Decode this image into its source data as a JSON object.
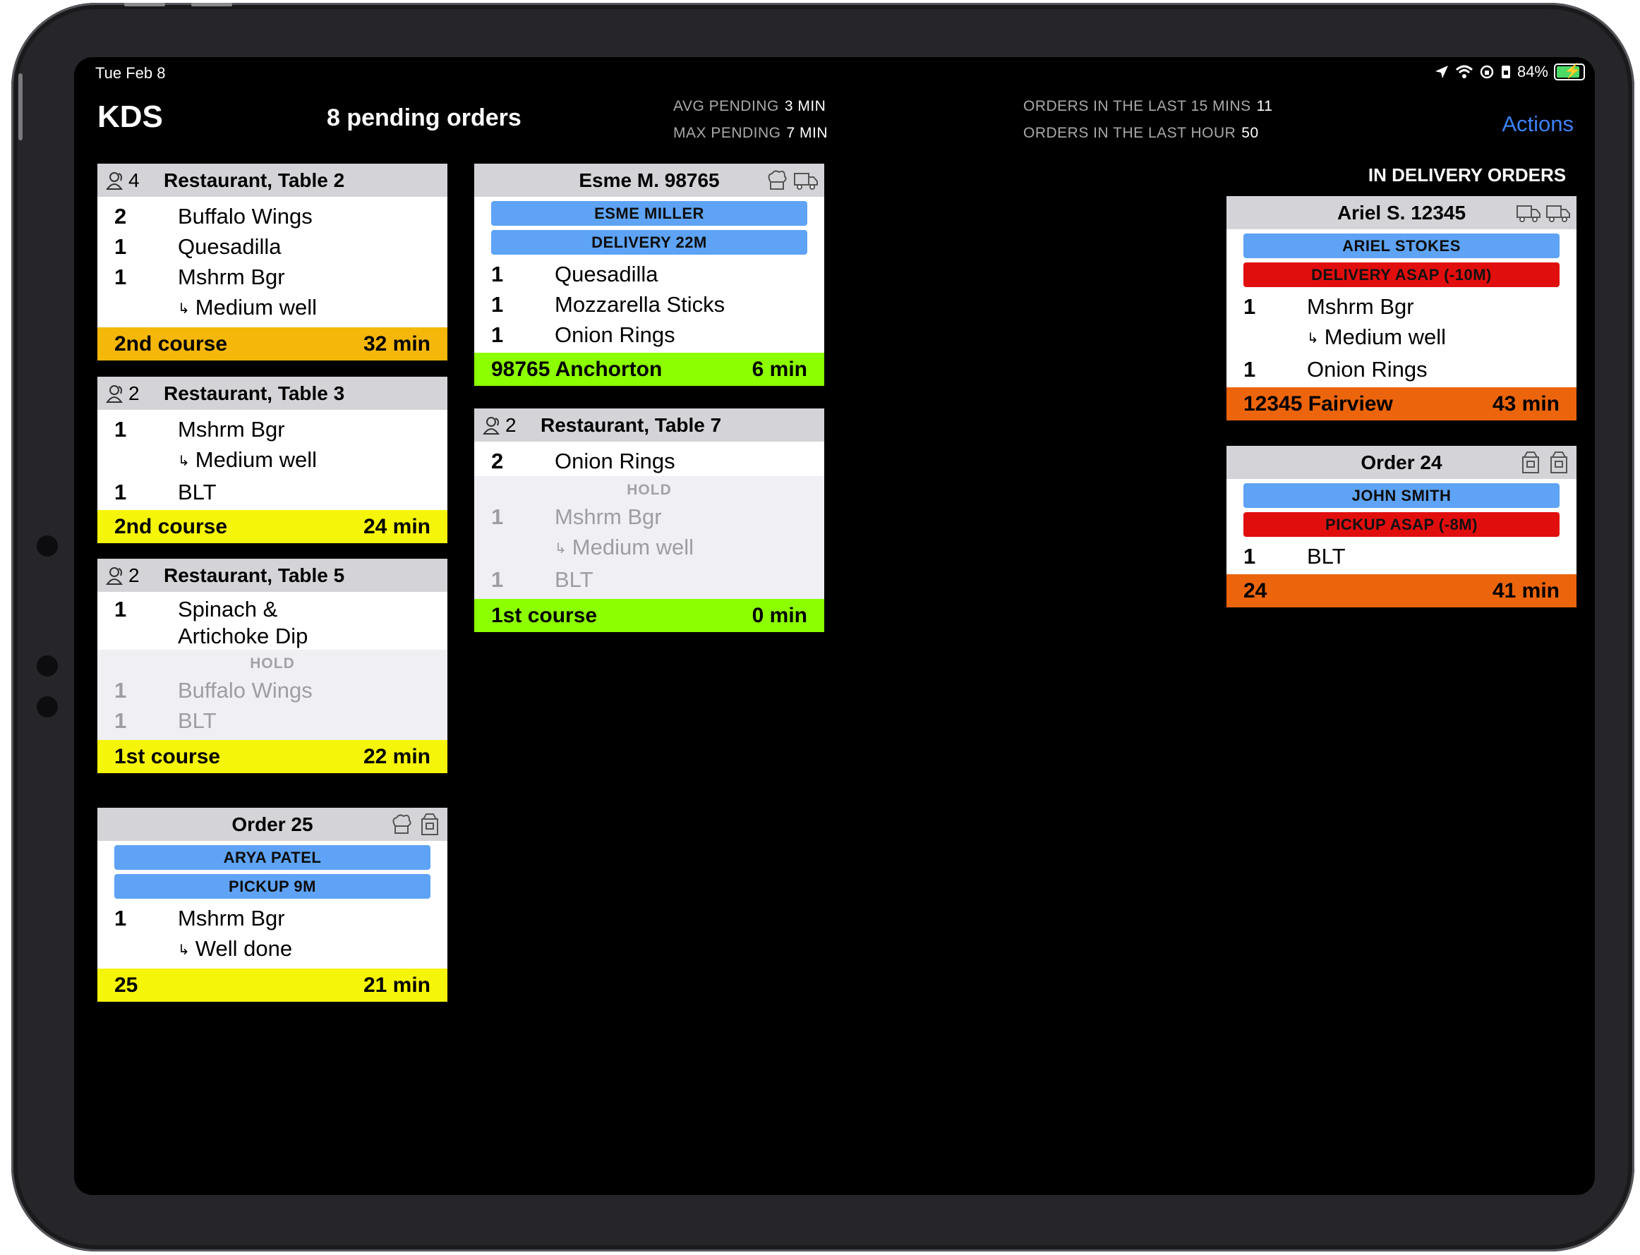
{
  "status_bar": {
    "date": "Tue Feb 8",
    "battery": "84%"
  },
  "header": {
    "title": "KDS",
    "pending": "8 pending orders",
    "avg_pending_label": "AVG PENDING",
    "avg_pending_value": "3 MIN",
    "max_pending_label": "MAX PENDING",
    "max_pending_value": "7 MIN",
    "last15_label": "ORDERS IN THE LAST 15 MINS",
    "last15_value": "11",
    "lasthour_label": "ORDERS IN THE LAST HOUR",
    "lasthour_value": "50",
    "actions": "Actions"
  },
  "delivery_heading": "IN DELIVERY ORDERS",
  "tickets": {
    "t2": {
      "guests": "4",
      "title": "Restaurant, Table 2",
      "items": [
        {
          "qty": "2",
          "name": "Buffalo Wings"
        },
        {
          "qty": "1",
          "name": "Quesadilla"
        },
        {
          "qty": "1",
          "name": "Mshrm Bgr"
        }
      ],
      "mods": [
        "Medium well"
      ],
      "footer_left": "2nd course",
      "footer_right": "32 min"
    },
    "t3": {
      "guests": "2",
      "title": "Restaurant, Table 3",
      "items": [
        {
          "qty": "1",
          "name": "Mshrm Bgr"
        },
        {
          "qty": "1",
          "name": "BLT"
        }
      ],
      "mods": [
        "Medium well"
      ],
      "footer_left": "2nd course",
      "footer_right": "24 min"
    },
    "t5": {
      "guests": "2",
      "title": "Restaurant, Table 5",
      "items": [
        {
          "qty": "1",
          "name": "Spinach &"
        },
        {
          "qty": "",
          "name": "Artichoke Dip"
        }
      ],
      "hold_label": "HOLD",
      "held": [
        {
          "qty": "1",
          "name": "Buffalo Wings"
        },
        {
          "qty": "1",
          "name": "BLT"
        }
      ],
      "footer_left": "1st course",
      "footer_right": "22 min"
    },
    "o25": {
      "title": "Order 25",
      "customer": "ARYA  PATEL",
      "timing": "PICKUP 9M",
      "items": [
        {
          "qty": "1",
          "name": "Mshrm Bgr"
        }
      ],
      "mods": [
        "Well done"
      ],
      "footer_left": "25",
      "footer_right": "21 min"
    },
    "esme": {
      "title": "Esme  M. 98765",
      "customer": "ESME  MILLER",
      "timing": "DELIVERY 22M",
      "items": [
        {
          "qty": "1",
          "name": "Quesadilla"
        },
        {
          "qty": "1",
          "name": "Mozzarella Sticks"
        },
        {
          "qty": "1",
          "name": "Onion Rings"
        }
      ],
      "footer_left": "98765 Anchorton",
      "footer_right": "6 min"
    },
    "t7": {
      "guests": "2",
      "title": "Restaurant, Table 7",
      "items": [
        {
          "qty": "2",
          "name": "Onion Rings"
        }
      ],
      "hold_label": "HOLD",
      "held": [
        {
          "qty": "1",
          "name": "Mshrm Bgr"
        },
        {
          "qty": "1",
          "name": "BLT"
        }
      ],
      "held_mods": [
        "Medium well"
      ],
      "footer_left": "1st course",
      "footer_right": "0 min"
    },
    "ariel": {
      "title": "Ariel  S. 12345",
      "customer": "ARIEL  STOKES",
      "timing": "DELIVERY ASAP (-10M)",
      "items": [
        {
          "qty": "1",
          "name": "Mshrm Bgr"
        },
        {
          "qty": "1",
          "name": "Onion Rings"
        }
      ],
      "mods": [
        "Medium well"
      ],
      "footer_left": "12345 Fairview",
      "footer_right": "43 min"
    },
    "o24": {
      "title": "Order 24",
      "customer": "JOHN SMITH",
      "timing": "PICKUP ASAP (-8M)",
      "items": [
        {
          "qty": "1",
          "name": "BLT"
        }
      ],
      "footer_left": "24",
      "footer_right": "41 min"
    }
  },
  "colors": {
    "footer_gold": "#f5b70a",
    "footer_yellow": "#f5f50a",
    "footer_green": "#8cff00",
    "footer_orange": "#ec650c",
    "pill_blue": "#5ea3f5",
    "pill_red": "#e10e0e",
    "actions_blue": "#3b82f6"
  }
}
